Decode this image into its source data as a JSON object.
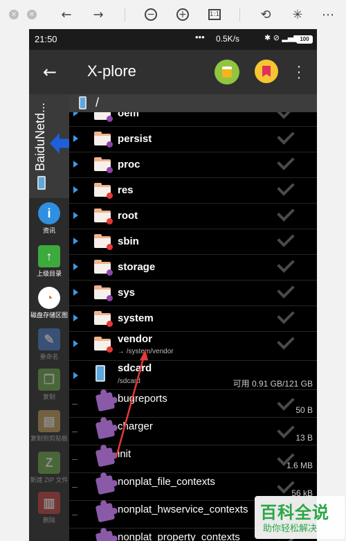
{
  "viewer": {
    "zoom_out_symbol": "−",
    "zoom_in_symbol": "+"
  },
  "status": {
    "time": "21:50",
    "network": "0.5K/s",
    "battery": "100"
  },
  "app": {
    "title": "X-plore"
  },
  "left_panel": {
    "tab_label": "BaiduNetd...",
    "buttons": [
      {
        "label": "资讯",
        "icon": "info-icon",
        "color": "#2f8fe0",
        "enabled": true
      },
      {
        "label": "上级目录",
        "icon": "up-arrow-icon",
        "color": "#3caa3c",
        "enabled": true
      },
      {
        "label": "磁盘存储区图",
        "icon": "disk-chart-icon",
        "color": "#ffffff",
        "enabled": true
      },
      {
        "label": "重命名",
        "icon": "rename-icon",
        "color": "#4a7fd0",
        "enabled": false
      },
      {
        "label": "复制",
        "icon": "copy-icon",
        "color": "#6fae4a",
        "enabled": false
      },
      {
        "label": "复制到剪贴板",
        "icon": "clipboard-icon",
        "color": "#c9a25a",
        "enabled": false
      },
      {
        "label": "新建 ZIP 文件",
        "icon": "zip-icon",
        "color": "#6fae4a",
        "enabled": false
      },
      {
        "label": "删除",
        "icon": "trash-icon",
        "color": "#d04040",
        "enabled": false
      }
    ]
  },
  "path": "/",
  "folders": [
    {
      "name": "oem",
      "dot": "#8e44ad"
    },
    {
      "name": "persist",
      "dot": "#8e44ad"
    },
    {
      "name": "proc",
      "dot": "#8e44ad"
    },
    {
      "name": "res",
      "dot": "#e53935"
    },
    {
      "name": "root",
      "dot": "#e53935"
    },
    {
      "name": "sbin",
      "dot": "#e53935"
    },
    {
      "name": "storage",
      "dot": "#8e44ad"
    },
    {
      "name": "sys",
      "dot": "#8e44ad"
    },
    {
      "name": "system",
      "dot": "#e53935"
    },
    {
      "name": "vendor",
      "dot": "#e53935",
      "link": "→ /system/vendor"
    }
  ],
  "sdcard": {
    "name": "sdcard",
    "path": "/sdcard",
    "free": "可用 0.91 GB/121 GB"
  },
  "files": [
    {
      "name": "bugreports",
      "size": "50 B"
    },
    {
      "name": "charger",
      "size": "13 B"
    },
    {
      "name": "init",
      "size": "1.6 MB"
    },
    {
      "name": "nonplat_file_contexts",
      "size": "56 kB"
    },
    {
      "name": "nonplat_hwservice_contexts",
      "size": ""
    },
    {
      "name": "nonplat_property_contexts",
      "size": ""
    }
  ],
  "watermark": {
    "logo": "百科全说",
    "sub": "助你轻松解决"
  }
}
